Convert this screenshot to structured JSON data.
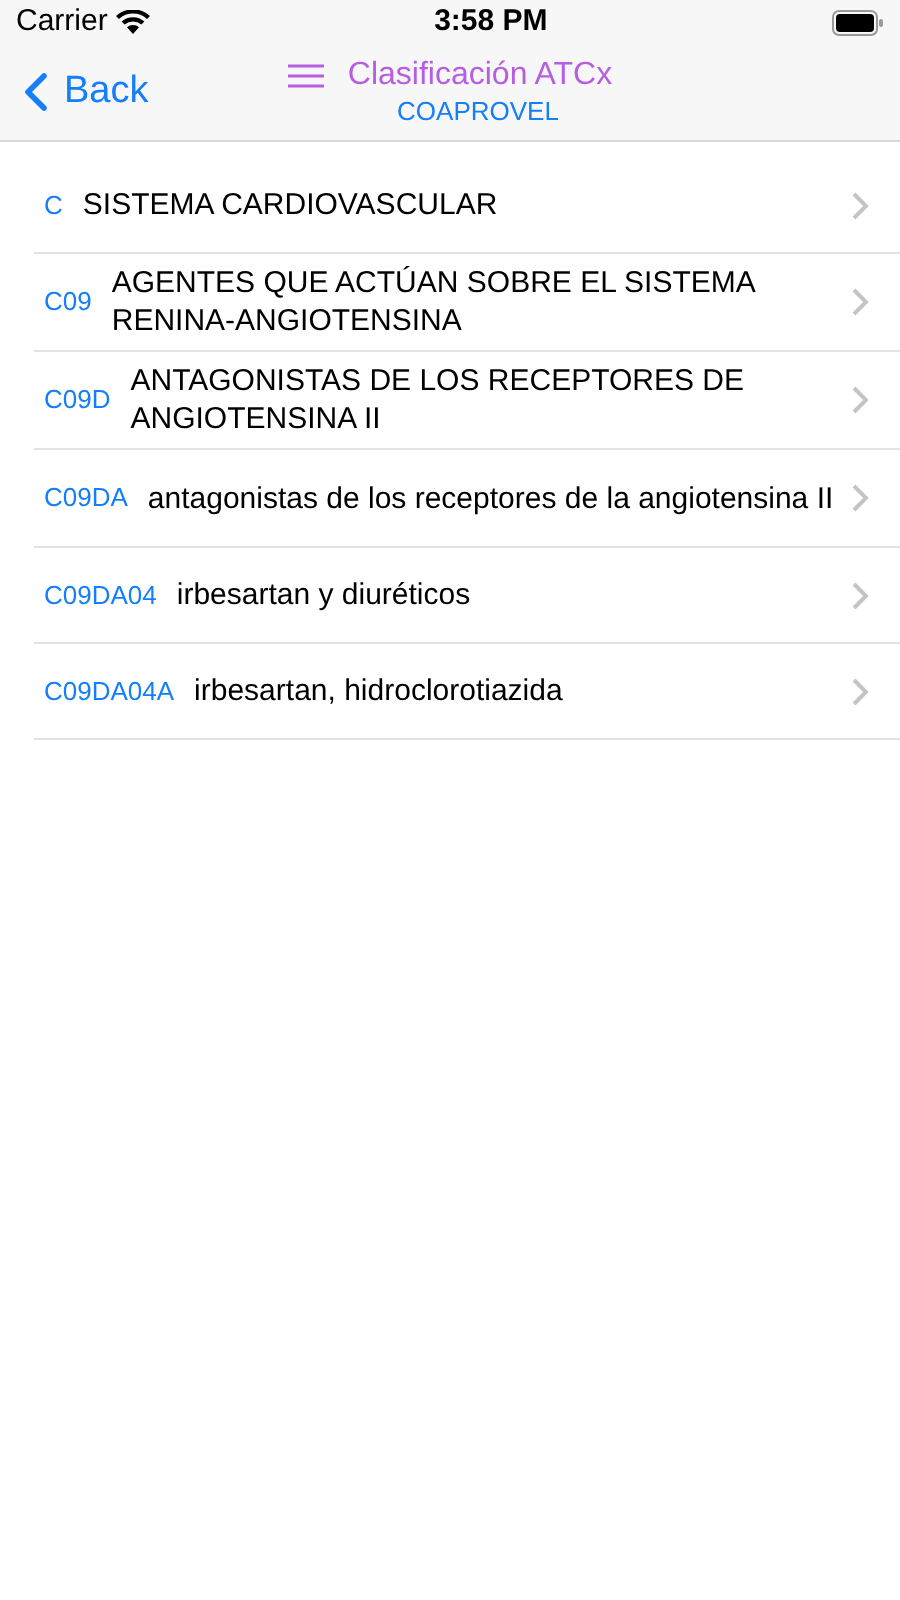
{
  "status_bar": {
    "carrier": "Carrier",
    "time": "3:58 PM"
  },
  "nav": {
    "back": "Back",
    "title": "Clasificación ATCx",
    "subtitle": "COAPROVEL"
  },
  "rows": [
    {
      "code": "C",
      "label": "SISTEMA CARDIOVASCULAR"
    },
    {
      "code": "C09",
      "label": "AGENTES QUE ACTÚAN SOBRE EL SISTEMA RENINA-ANGIOTENSINA"
    },
    {
      "code": "C09D",
      "label": "ANTAGONISTAS DE LOS RECEPTORES DE ANGIOTENSINA II"
    },
    {
      "code": "C09DA",
      "label": "antagonistas de los receptores de la angiotensina II"
    },
    {
      "code": "C09DA04",
      "label": "irbesartan y diuréticos"
    },
    {
      "code": "C09DA04A",
      "label": "irbesartan, hidroclorotiazida"
    }
  ]
}
